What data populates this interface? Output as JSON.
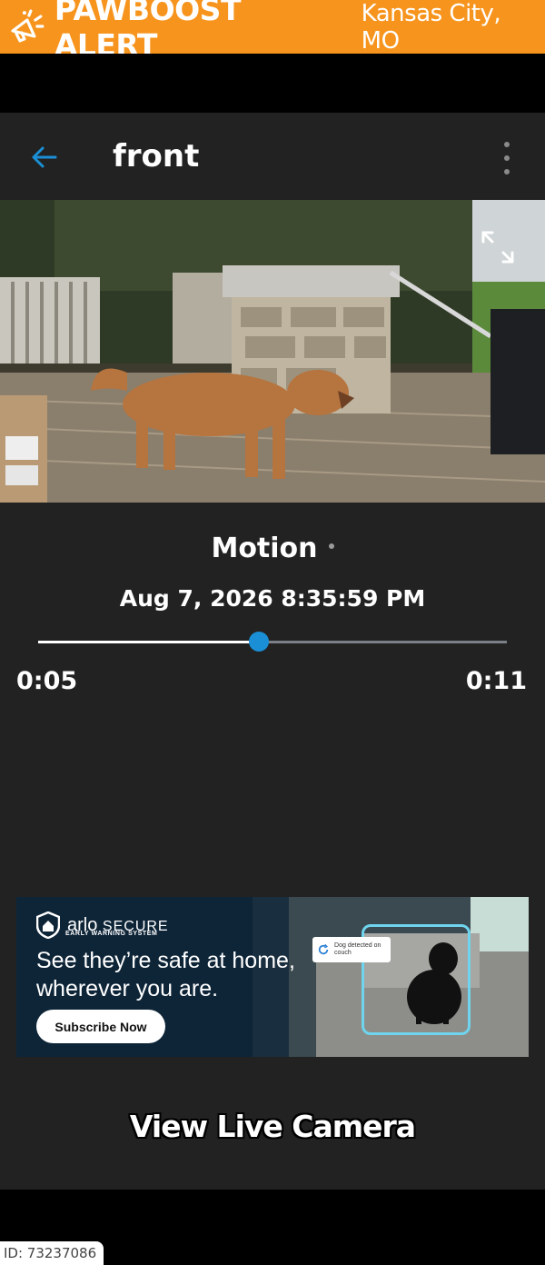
{
  "alert": {
    "icon": "megaphone-icon",
    "title": "PAWBOOST ALERT",
    "location": "Kansas City, MO",
    "color": "#f7941d"
  },
  "toolbar": {
    "back_icon": "arrow-left-icon",
    "title": "front",
    "menu_icon": "more-vertical-icon"
  },
  "video": {
    "expand_icon": "expand-icon"
  },
  "event": {
    "type": "Motion",
    "timestamp": "Aug 7, 2026 8:35:59 PM"
  },
  "playback": {
    "current": "0:05",
    "duration": "0:11",
    "progress": 0.47,
    "accent": "#1b8fd6"
  },
  "ad": {
    "brand": "arlo",
    "brand_secure": "SECURE",
    "subtitle": "EARLY WARNING SYSTEM",
    "headline": "See they’re safe at home, wherever you are.",
    "cta": "Subscribe Now",
    "detect_label": "Dog detected on couch"
  },
  "live_button": "View Live Camera",
  "footer": {
    "id_label": "ID: 73237086"
  }
}
